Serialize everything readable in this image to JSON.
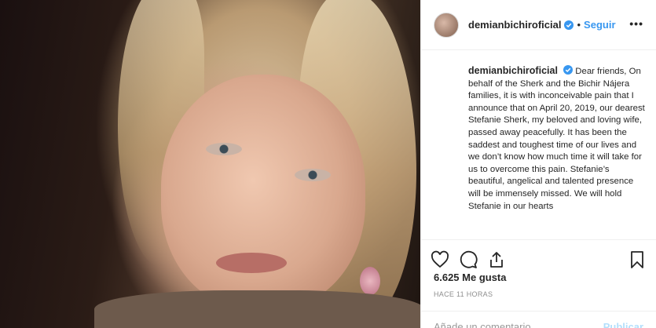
{
  "post": {
    "username": "demianbichiroficial",
    "dot": "•",
    "follow_label": "Seguir",
    "more_label": "•••",
    "caption_user": "demianbichiroficial",
    "caption_text": "Dear friends, On behalf of the Sherk and the Bichir Nájera families, it is with inconceivable pain that I announce that on April 20, 2019, our dearest Stefanie Sherk, my beloved and loving wife, passed away peacefully. It has been the saddest and toughest time of our lives and we don’t know how much time it will take for us to overcome this pain. Stefanie’s beautiful, angelical and talented presence will be immensely missed. We will hold Stefanie in our hearts",
    "likes": "6.625 Me gusta",
    "time": "HACE 11 HORAS",
    "comment_placeholder": "Añade un comentario...",
    "publish_label": "Publicar"
  },
  "colors": {
    "accent": "#3897f0",
    "publish_disabled": "#b2dffc",
    "text": "#262626",
    "muted": "#8e8e8e"
  },
  "icons": [
    "verified-badge-icon",
    "heart-icon",
    "comment-icon",
    "share-icon",
    "bookmark-icon"
  ]
}
